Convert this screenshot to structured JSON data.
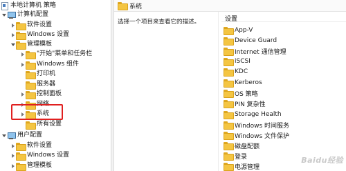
{
  "tree": {
    "root": "本地计算机 策略",
    "computer_config": "计算机配置",
    "software_settings": "软件设置",
    "windows_settings": "Windows 设置",
    "admin_templates": "管理模板",
    "start_menu": "\"开始\"菜单和任务栏",
    "windows_components": "Windows 组件",
    "printers": "打印机",
    "server": "服务器",
    "control_panel": "控制面板",
    "network": "网络",
    "system": "系统",
    "all_settings": "所有设置",
    "user_config": "用户配置",
    "user_software_settings": "软件设置",
    "user_windows_settings": "Windows 设置",
    "user_admin_templates": "管理模板"
  },
  "right": {
    "header": "系统",
    "description": "选择一个项目来查看它的描述。",
    "column": "设置",
    "items": [
      "App-V",
      "Device Guard",
      "Internet 通信管理",
      "iSCSI",
      "KDC",
      "Kerberos",
      "OS 策略",
      "PIN 复杂性",
      "Storage Health",
      "Windows 时间服务",
      "Windows 文件保护",
      "磁盘配额",
      "登录",
      "电源管理"
    ]
  },
  "watermark": "Baidu经验",
  "colors": {
    "highlight": "#e02020",
    "folder": "#f4c542"
  }
}
